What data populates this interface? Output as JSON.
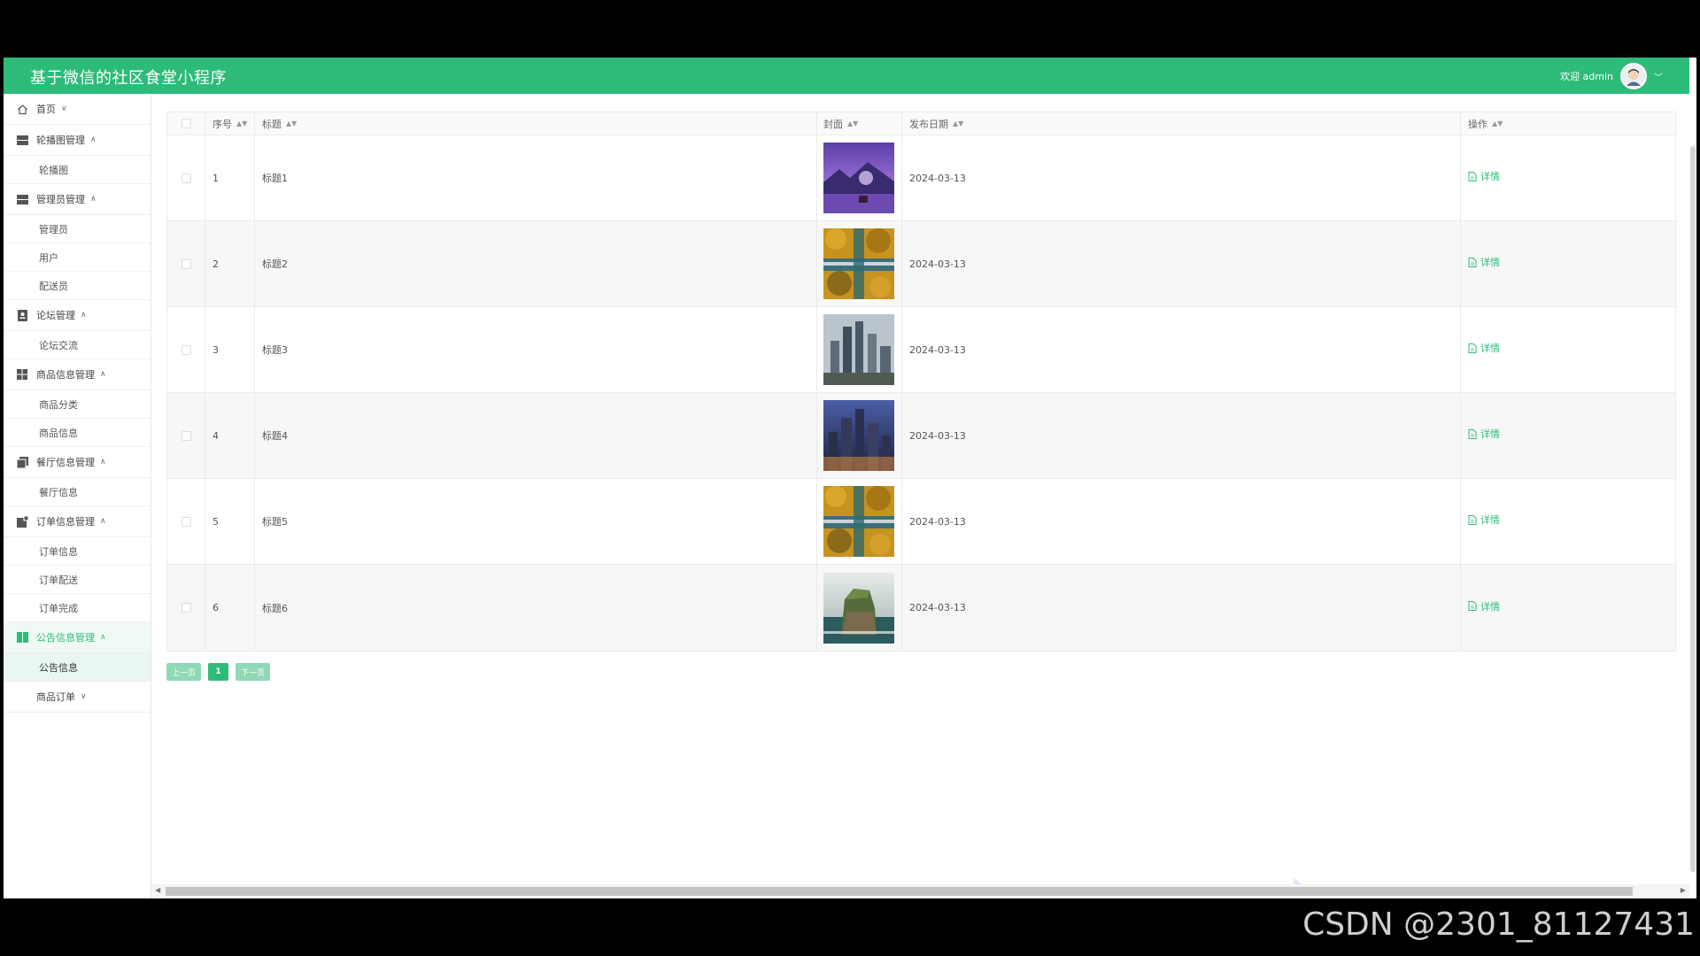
{
  "header": {
    "title": "基于微信的社区食堂小程序",
    "welcome": "欢迎 admin"
  },
  "sidebar": {
    "groups": [
      {
        "label": "首页",
        "icon": "home-icon",
        "subs": []
      },
      {
        "label": "轮播图管理",
        "icon": "list-icon",
        "subs": [
          "轮播图"
        ]
      },
      {
        "label": "管理员管理",
        "icon": "list-icon",
        "subs": [
          "管理员",
          "用户",
          "配送员"
        ]
      },
      {
        "label": "论坛管理",
        "icon": "id-card-icon",
        "subs": [
          "论坛交流"
        ]
      },
      {
        "label": "商品信息管理",
        "icon": "grid-icon",
        "subs": [
          "商品分类",
          "商品信息"
        ]
      },
      {
        "label": "餐厅信息管理",
        "icon": "copy-icon",
        "subs": [
          "餐厅信息"
        ]
      },
      {
        "label": "订单信息管理",
        "icon": "order-icon",
        "subs": [
          "订单信息",
          "订单配送",
          "订单完成"
        ]
      },
      {
        "label": "公告信息管理",
        "icon": "notice-icon",
        "subs": [
          "公告信息"
        ]
      },
      {
        "label": "商品订单",
        "icon": "none",
        "subs": []
      }
    ]
  },
  "table": {
    "columns": {
      "index": "序号",
      "title": "标题",
      "cover": "封面",
      "date": "发布日期",
      "action": "操作"
    },
    "rows": [
      {
        "index": "1",
        "title": "标题1",
        "date": "2024-03-13",
        "action": "详情",
        "cover": "purple-night-lake"
      },
      {
        "index": "2",
        "title": "标题2",
        "date": "2024-03-13",
        "action": "详情",
        "cover": "autumn-forest-road"
      },
      {
        "index": "3",
        "title": "标题3",
        "date": "2024-03-13",
        "action": "详情",
        "cover": "city-skyscrapers"
      },
      {
        "index": "4",
        "title": "标题4",
        "date": "2024-03-13",
        "action": "详情",
        "cover": "city-night-skyline"
      },
      {
        "index": "5",
        "title": "标题5",
        "date": "2024-03-13",
        "action": "详情",
        "cover": "autumn-forest-road"
      },
      {
        "index": "6",
        "title": "标题6",
        "date": "2024-03-13",
        "action": "详情",
        "cover": "sea-rock-island"
      }
    ]
  },
  "pagination": {
    "prev": "上一页",
    "current": "1",
    "next": "下一页"
  },
  "watermark": "CSDN @2301_81127431",
  "colors": {
    "accent": "#2dbb79",
    "accent_light": "#8fd9b4"
  }
}
